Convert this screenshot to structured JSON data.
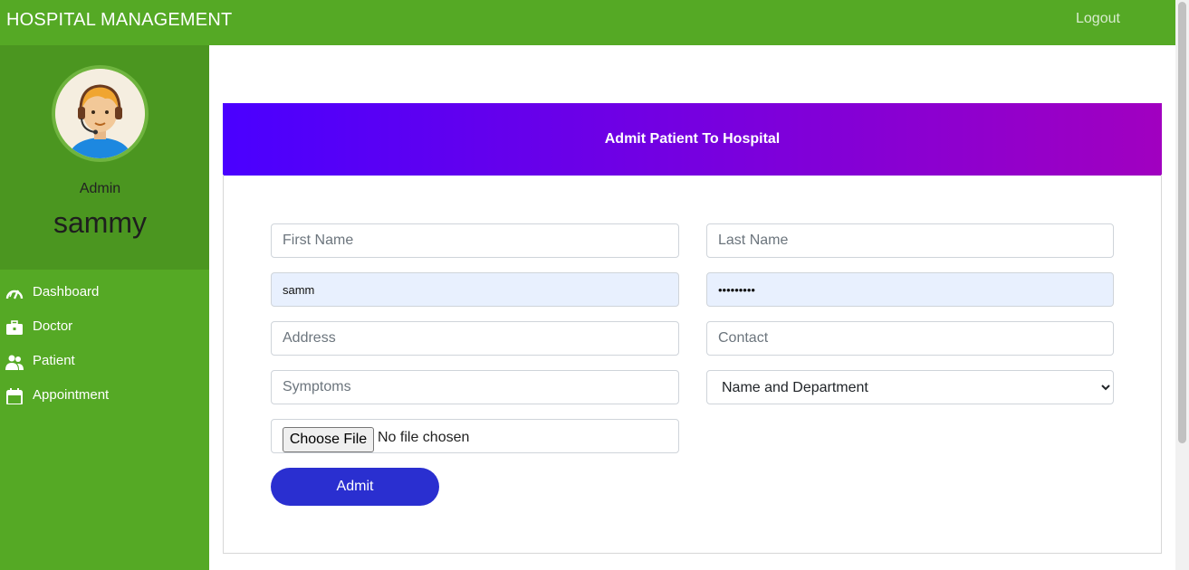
{
  "header": {
    "brand": "HOSPITAL MANAGEMENT",
    "logout_label": "Logout"
  },
  "sidebar": {
    "role": "Admin",
    "username": "sammy",
    "items": [
      {
        "label": "Dashboard",
        "icon": "speedometer-icon"
      },
      {
        "label": "Doctor",
        "icon": "briefcase-icon"
      },
      {
        "label": "Patient",
        "icon": "users-icon"
      },
      {
        "label": "Appointment",
        "icon": "calendar-icon"
      }
    ]
  },
  "form": {
    "title": "Admit Patient To Hospital",
    "first_name_placeholder": "First Name",
    "last_name_placeholder": "Last Name",
    "username_value": "samm",
    "password_value": "•••••••••",
    "address_placeholder": "Address",
    "contact_placeholder": "Contact",
    "symptoms_placeholder": "Symptoms",
    "doctor_select_value": "Name and Department",
    "file_button_label": "Choose File",
    "file_status": "No file chosen",
    "submit_label": "Admit"
  },
  "colors": {
    "accent_green": "#55a925",
    "profile_green": "#4b9620",
    "button_blue": "#2a2fd0"
  }
}
